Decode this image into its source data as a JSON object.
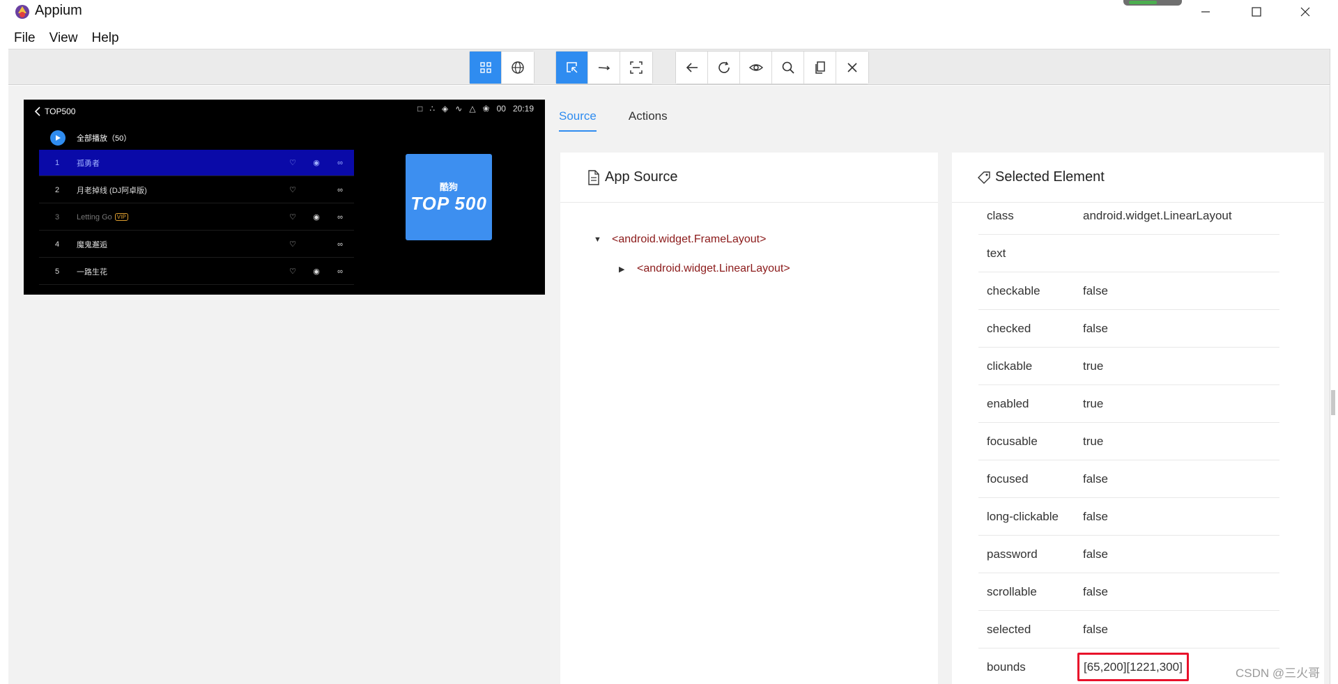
{
  "window": {
    "title": "Appium"
  },
  "menu": {
    "items": [
      "File",
      "View",
      "Help"
    ]
  },
  "toolbar": {
    "groups": [
      [
        "grid-icon",
        "globe-icon"
      ],
      [
        "select-element-icon",
        "swipe-icon",
        "tap-coords-icon"
      ],
      [
        "back-icon",
        "refresh-icon",
        "eye-icon",
        "search-icon",
        "copy-icon",
        "close-icon"
      ]
    ],
    "accent": "#2f8cf0"
  },
  "device_screen": {
    "back_label": "TOP500",
    "status_time": "20:19",
    "status_extra": "00",
    "play_all": "全部播放（50）",
    "songs": [
      {
        "num": "1",
        "title": "孤勇者",
        "vip": ""
      },
      {
        "num": "2",
        "title": "月老掉线 (DJ阿卓版)",
        "vip": ""
      },
      {
        "num": "3",
        "title": "Letting Go",
        "vip": "VIP"
      },
      {
        "num": "4",
        "title": "魔鬼邂逅",
        "vip": ""
      },
      {
        "num": "5",
        "title": "一路生花",
        "vip": ""
      }
    ],
    "cover_sub": "酷狗",
    "cover_title": "TOP 500"
  },
  "tabs": {
    "source": "Source",
    "actions": "Actions"
  },
  "app_source": {
    "title": "App Source",
    "nodes": [
      "<android.widget.FrameLayout>",
      "<android.widget.LinearLayout>"
    ]
  },
  "selected_element": {
    "title": "Selected Element",
    "attributes": [
      {
        "name": "class",
        "value": "android.widget.LinearLayout"
      },
      {
        "name": "text",
        "value": ""
      },
      {
        "name": "checkable",
        "value": "false"
      },
      {
        "name": "checked",
        "value": "false"
      },
      {
        "name": "clickable",
        "value": "true"
      },
      {
        "name": "enabled",
        "value": "true"
      },
      {
        "name": "focusable",
        "value": "true"
      },
      {
        "name": "focused",
        "value": "false"
      },
      {
        "name": "long-clickable",
        "value": "false"
      },
      {
        "name": "password",
        "value": "false"
      },
      {
        "name": "scrollable",
        "value": "false"
      },
      {
        "name": "selected",
        "value": "false"
      },
      {
        "name": "bounds",
        "value": "[65,200][1221,300]"
      }
    ]
  },
  "watermark": "CSDN @三火哥"
}
